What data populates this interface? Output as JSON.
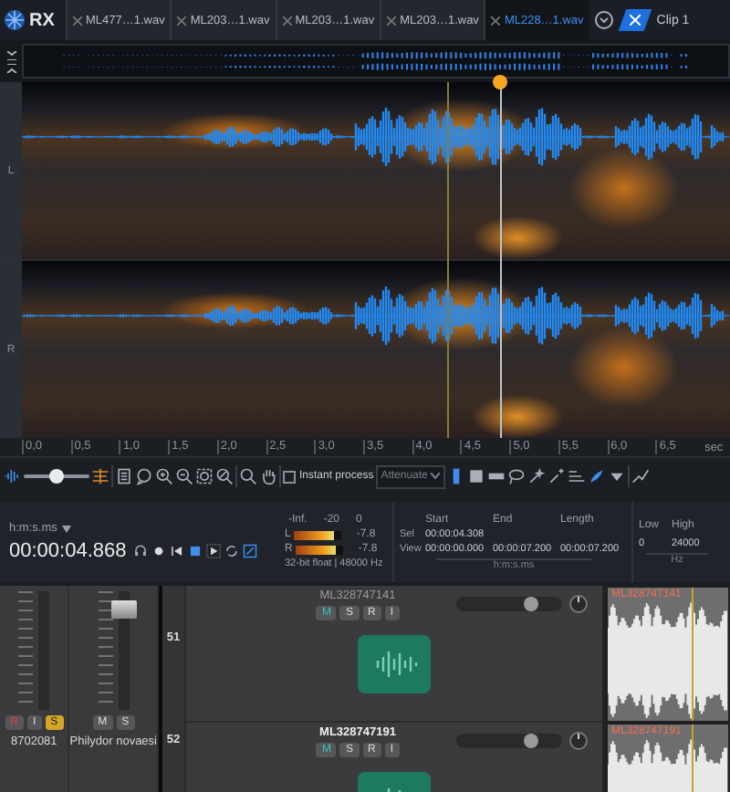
{
  "logo": {
    "text": "RX"
  },
  "tabs": [
    {
      "label": "ML477…1.wav",
      "selected": false
    },
    {
      "label": "ML203…1.wav",
      "selected": false
    },
    {
      "label": "ML203…1.wav",
      "selected": false
    },
    {
      "label": "ML203…1.wav",
      "selected": false
    },
    {
      "label": "ML228…1.wav",
      "selected": true
    }
  ],
  "clip_tab": {
    "label": "Clip 1"
  },
  "channels": [
    {
      "label": "L"
    },
    {
      "label": "R"
    }
  ],
  "time_ruler": {
    "ticks": [
      "0,0",
      "0,5",
      "1,0",
      "1,5",
      "2,0",
      "2,5",
      "3,0",
      "3,5",
      "4,0",
      "4,5",
      "5,0",
      "5,5",
      "6,0",
      "6,5"
    ],
    "unit": "sec"
  },
  "toolbar": {
    "level": 0.5,
    "instant_process": {
      "label": "Instant process",
      "checked": false
    },
    "mode": {
      "value": "Attenuate"
    }
  },
  "transport": {
    "format": "h:m:s.ms",
    "time": "00:00:04.868"
  },
  "meter": {
    "scale": [
      "-Inf.",
      "-20",
      "0"
    ],
    "channels": [
      {
        "label": "L",
        "level": 0.85,
        "reading": "-7.8"
      },
      {
        "label": "R",
        "level": 0.85,
        "reading": "-7.8"
      }
    ],
    "format": "32-bit float | 48000 Hz"
  },
  "selection": {
    "columns": [
      "Start",
      "End",
      "Length"
    ],
    "rows": [
      {
        "label": "Sel",
        "values": [
          "00:00:04.308"
        ]
      },
      {
        "label": "View",
        "values": [
          "00:00:00.000",
          "00:00:07.200",
          "00:00:07.200"
        ]
      }
    ],
    "unit": "h:m:s.ms"
  },
  "frequency": {
    "columns": [
      "Low",
      "High"
    ],
    "values": [
      "0",
      "24000"
    ],
    "unit": "Hz"
  },
  "mixer": [
    {
      "name": "8702081",
      "buttons": [
        {
          "label": "R",
          "on": true,
          "kind": "record"
        },
        {
          "label": "I",
          "on": false,
          "kind": "input"
        },
        {
          "label": "S",
          "on": true,
          "kind": "solo"
        }
      ]
    },
    {
      "name": "Philydor novaesi",
      "level": 0.85,
      "buttons": [
        {
          "label": "M",
          "on": false,
          "kind": "mute"
        },
        {
          "label": "S",
          "on": false,
          "kind": "solo"
        }
      ]
    }
  ],
  "tracks": [
    {
      "number": "51",
      "name": "ML328747141",
      "selected": false,
      "level": 0.7,
      "buttons": [
        {
          "label": "M",
          "on": true
        },
        {
          "label": "S",
          "on": false
        },
        {
          "label": "R",
          "on": false
        },
        {
          "label": "I",
          "on": false
        }
      ]
    },
    {
      "number": "52",
      "name": "ML328747191",
      "selected": true,
      "level": 0.7,
      "buttons": [
        {
          "label": "M",
          "on": true
        },
        {
          "label": "S",
          "on": false
        },
        {
          "label": "R",
          "on": false
        },
        {
          "label": "I",
          "on": false
        }
      ]
    }
  ],
  "clips": [
    {
      "name": "ML328747141"
    },
    {
      "name": "ML328747191"
    }
  ]
}
